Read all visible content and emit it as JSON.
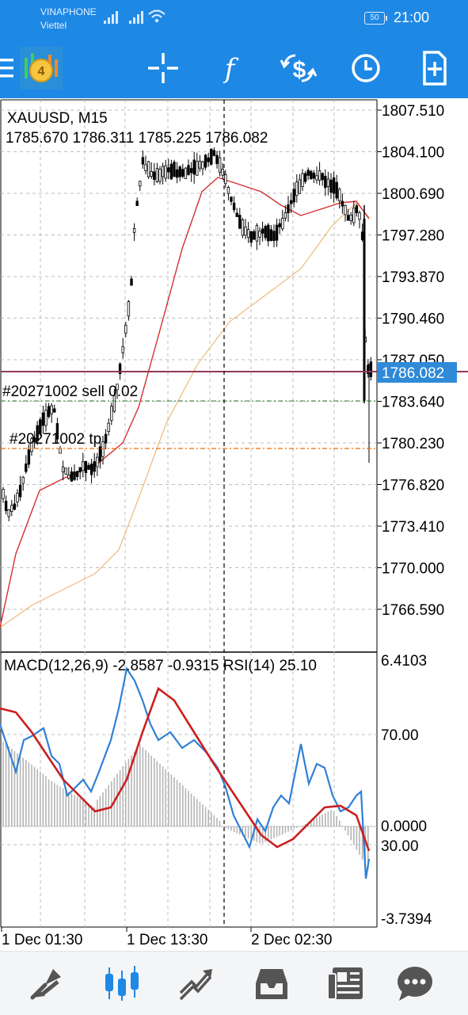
{
  "status_bar": {
    "carrier_1": "VINAPHONE",
    "carrier_2": "Viettel",
    "battery": "50",
    "time": "21:00"
  },
  "toolbar": {
    "items": [
      "menu-icon",
      "app-logo",
      "crosshair-icon",
      "function-icon",
      "currency-exchange-icon",
      "clock-icon",
      "new-order-icon"
    ]
  },
  "chart": {
    "symbol_timeframe": "XAUUSD, M15",
    "ohlc": "1785.670 1786.311 1785.225 1786.082",
    "price_scale": [
      "1807.510",
      "1804.100",
      "1800.690",
      "1797.280",
      "1793.870",
      "1790.460",
      "1787.050",
      "1783.640",
      "1780.230",
      "1776.820",
      "1773.410",
      "1770.000",
      "1766.590"
    ],
    "current_price": "1786.082",
    "order_label": "#20271002 sell 0.02",
    "tp_label": "#20271002 tp",
    "indicator_header": "MACD(12,26,9) -2.8587 -0.9315 RSI(14) 25.10",
    "indicator_scale": [
      "6.4103",
      "70.00",
      "0.0000",
      "30.00",
      "-3.7394"
    ],
    "time_labels": [
      "1 Dec 01:30",
      "1 Dec 13:30",
      "2 Dec 02:30"
    ],
    "colors": {
      "accent": "#1e88e5",
      "ma_fast": "#d32f2f",
      "ma_slow": "#f0b97a",
      "current_price_line": "#8e3a59",
      "sell_line": "#2e7d32",
      "tp_line": "#ef6c00",
      "rsi": "#2f80d6",
      "macd_signal": "#cc1f1f"
    }
  },
  "bottom_nav": {
    "items": [
      "quotes-icon",
      "chart-icon",
      "trade-icon",
      "history-icon",
      "news-icon",
      "messages-icon"
    ],
    "active": "chart-icon"
  }
}
